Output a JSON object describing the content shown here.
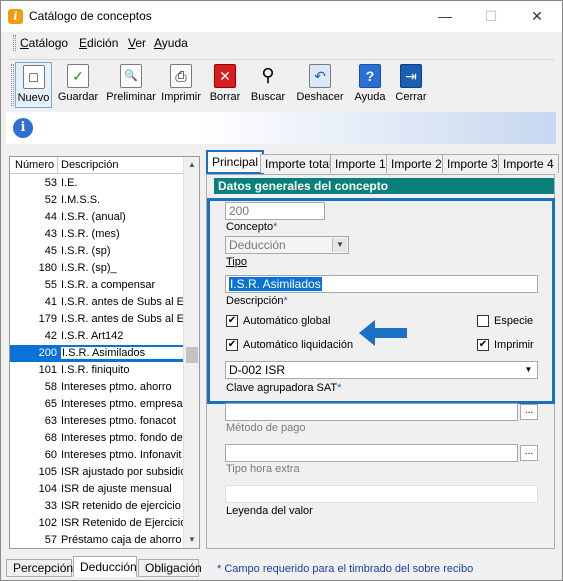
{
  "window": {
    "title": "Catálogo de conceptos",
    "minimize": "—",
    "maximize": "☐",
    "close": "✕"
  },
  "menu": [
    {
      "mnemonic": "C",
      "rest": "atálogo"
    },
    {
      "mnemonic": "E",
      "rest": "dición"
    },
    {
      "mnemonic": "V",
      "rest": "er"
    },
    {
      "mnemonic": "A",
      "rest": "yuda"
    }
  ],
  "toolbar": [
    {
      "label": "Nuevo",
      "icon": "new-document-icon",
      "glyph": "□"
    },
    {
      "label": "Guardar",
      "icon": "save-check-icon",
      "glyph": "✓"
    },
    {
      "label": "Preliminar",
      "icon": "print-preview-icon",
      "glyph": "🔍"
    },
    {
      "label": "Imprimir",
      "icon": "printer-icon",
      "glyph": "⎙"
    },
    {
      "label": "Borrar",
      "icon": "delete-x-icon",
      "glyph": "✕"
    },
    {
      "label": "Buscar",
      "icon": "binoculars-icon",
      "glyph": "⚲"
    },
    {
      "label": "Deshacer",
      "icon": "undo-icon",
      "glyph": "↶"
    },
    {
      "label": "Ayuda",
      "icon": "help-icon",
      "glyph": "?"
    },
    {
      "label": "Cerrar",
      "icon": "exit-icon",
      "glyph": "⇥"
    }
  ],
  "info_icon": "i",
  "list": {
    "headers": {
      "number": "Número",
      "description": "Descripción"
    },
    "rows": [
      {
        "num": "53",
        "desc": "I.E."
      },
      {
        "num": "52",
        "desc": "I.M.S.S."
      },
      {
        "num": "44",
        "desc": "I.S.R. (anual)"
      },
      {
        "num": "43",
        "desc": "I.S.R. (mes)"
      },
      {
        "num": "45",
        "desc": "I.S.R. (sp)"
      },
      {
        "num": "180",
        "desc": "I.S.R. (sp)_"
      },
      {
        "num": "55",
        "desc": "I.S.R. a compensar"
      },
      {
        "num": "41",
        "desc": "I.S.R. antes de Subs al Er"
      },
      {
        "num": "179",
        "desc": "I.S.R. antes de Subs al Er"
      },
      {
        "num": "42",
        "desc": "I.S.R. Art142"
      },
      {
        "num": "200",
        "desc": "I.S.R. Asimilados",
        "selected": true
      },
      {
        "num": "101",
        "desc": "I.S.R. finiquito"
      },
      {
        "num": "58",
        "desc": "Intereses ptmo. ahorro"
      },
      {
        "num": "65",
        "desc": "Intereses ptmo. empresa"
      },
      {
        "num": "63",
        "desc": "Intereses ptmo. fonacot"
      },
      {
        "num": "68",
        "desc": "Intereses ptmo. fondo de a"
      },
      {
        "num": "60",
        "desc": "Intereses ptmo. Infonavit"
      },
      {
        "num": "105",
        "desc": "ISR ajustado por subsidio"
      },
      {
        "num": "104",
        "desc": "ISR de ajuste mensual"
      },
      {
        "num": "33",
        "desc": "ISR retenido de ejercicio a"
      },
      {
        "num": "102",
        "desc": "ISR Retenido de Ejercicio"
      },
      {
        "num": "57",
        "desc": "Préstamo caja de ahorro"
      }
    ]
  },
  "bottom_tabs": [
    "Percepción",
    "Deducción",
    "Obligación"
  ],
  "right_tabs": [
    {
      "label": "Principal",
      "active": true
    },
    {
      "label": "Importe total"
    },
    {
      "label": "Importe 1"
    },
    {
      "label": "Importe 2"
    },
    {
      "label": "Importe 3"
    },
    {
      "label": "Importe 4"
    }
  ],
  "form": {
    "section_title": "Datos generales del concepto",
    "concepto_value": "200",
    "concepto_label": "Concepto",
    "tipo_value": "Deducción",
    "tipo_label": "Tipo",
    "descripcion_value": "I.S.R. Asimilados",
    "descripcion_label": "Descripción",
    "chk_automatico_global": "Automático global",
    "chk_automatico_liquidacion": "Automático liquidación",
    "chk_especie": "Especie",
    "chk_imprimir": "Imprimir",
    "clave_sat_value": "D-002  ISR",
    "clave_sat_label": "Clave agrupadora SAT",
    "metodo_pago_label": "Método de pago",
    "tipo_hora_label": "Tipo hora extra",
    "leyenda_label": "Leyenda del valor",
    "required_mark": "*"
  },
  "footnote": "* Campo requerido para el timbrado del sobre recibo",
  "colors": {
    "accent": "#1a6fbf",
    "section": "#0b7f79",
    "selection": "#0a72d6"
  }
}
